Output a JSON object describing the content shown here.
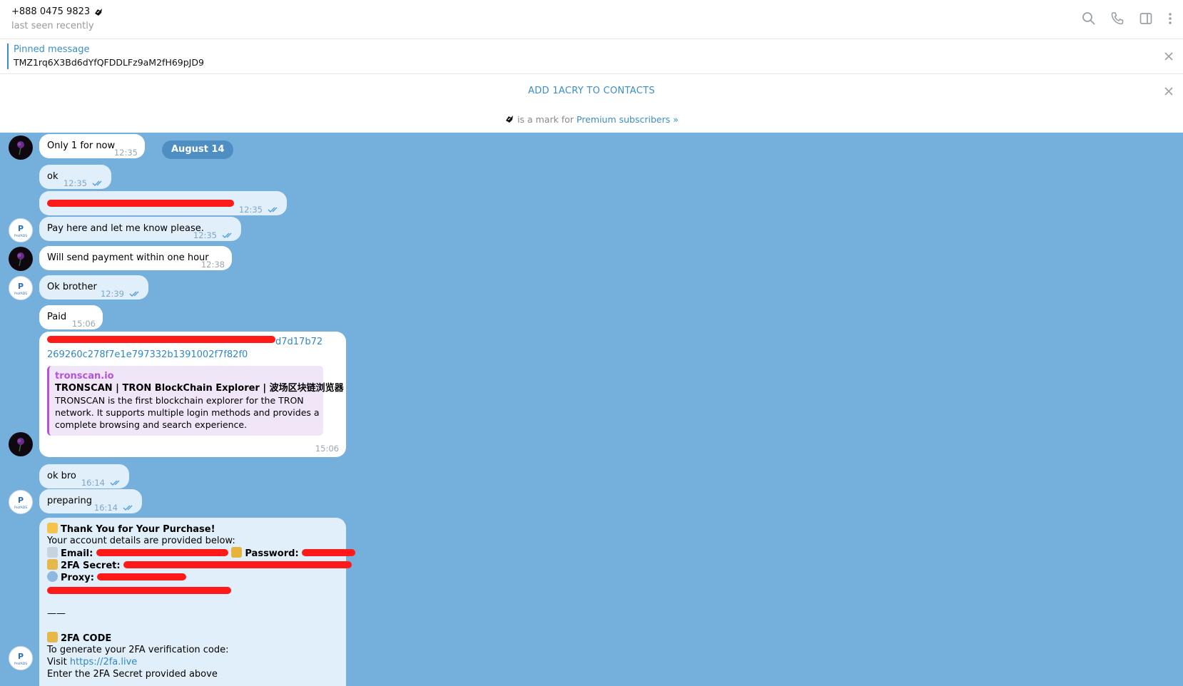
{
  "header": {
    "contact_name": "+888 0475 9823",
    "status": "last seen recently",
    "icons": [
      "search-icon",
      "phone-icon",
      "sidebar-toggle-icon",
      "more-vertical-icon"
    ]
  },
  "pinned": {
    "title": "Pinned message",
    "text": "TMZ1rq6X3Bd6dYfQFDDLFz9aM2fH69pJD9"
  },
  "add_contact": {
    "label": "ADD 1ACRY TO CONTACTS",
    "premium_note_text": "is a mark for",
    "premium_link": "Premium subscribers »"
  },
  "date_pill": "August 14",
  "messages": [
    {
      "text": "Only 1 for now",
      "time": "12:35",
      "dir": "in"
    },
    {
      "text": "ok",
      "time": "12:35",
      "dir": "out"
    },
    {
      "text": "",
      "time": "12:35",
      "dir": "out",
      "redacted": true
    },
    {
      "text": "Pay here and let me know please.",
      "time": "12:35",
      "dir": "out"
    },
    {
      "text": "Will send payment within one hour",
      "time": "12:38",
      "dir": "in"
    },
    {
      "text": "Ok brother",
      "time": "12:39",
      "dir": "out"
    },
    {
      "text": "Paid",
      "time": "15:06",
      "dir": "in"
    },
    {
      "link_line1": "d7d17b72",
      "link_line2": "269260c278f7e1e797332b1391002f7f82f0",
      "time": "15:06",
      "dir": "in",
      "preview": {
        "site": "tronscan.io",
        "title": "TRONSCAN | TRON BlockChain Explorer | 波场区块链浏览器",
        "description": "TRONSCAN is the first blockchain explorer for the TRON network. It supports multiple login methods and provides a complete browsing and search experience."
      }
    },
    {
      "text": "ok bro",
      "time": "16:14",
      "dir": "out"
    },
    {
      "text": "preparing",
      "time": "16:14",
      "dir": "out"
    },
    {
      "dir": "out",
      "heading": "Thank You for Your Purchase!",
      "intro": "Your account details are provided below:",
      "email_label": "Email:",
      "password_label": "Password:",
      "secret_label": "2FA Secret:",
      "proxy_label": "Proxy:",
      "separator": "——",
      "code_heading": "2FA CODE",
      "code_intro": "To generate your 2FA verification code:",
      "visit_label": "Visit",
      "visit_link": "https://2fa.live",
      "last_line": "Enter the 2FA Secret provided above"
    }
  ]
}
